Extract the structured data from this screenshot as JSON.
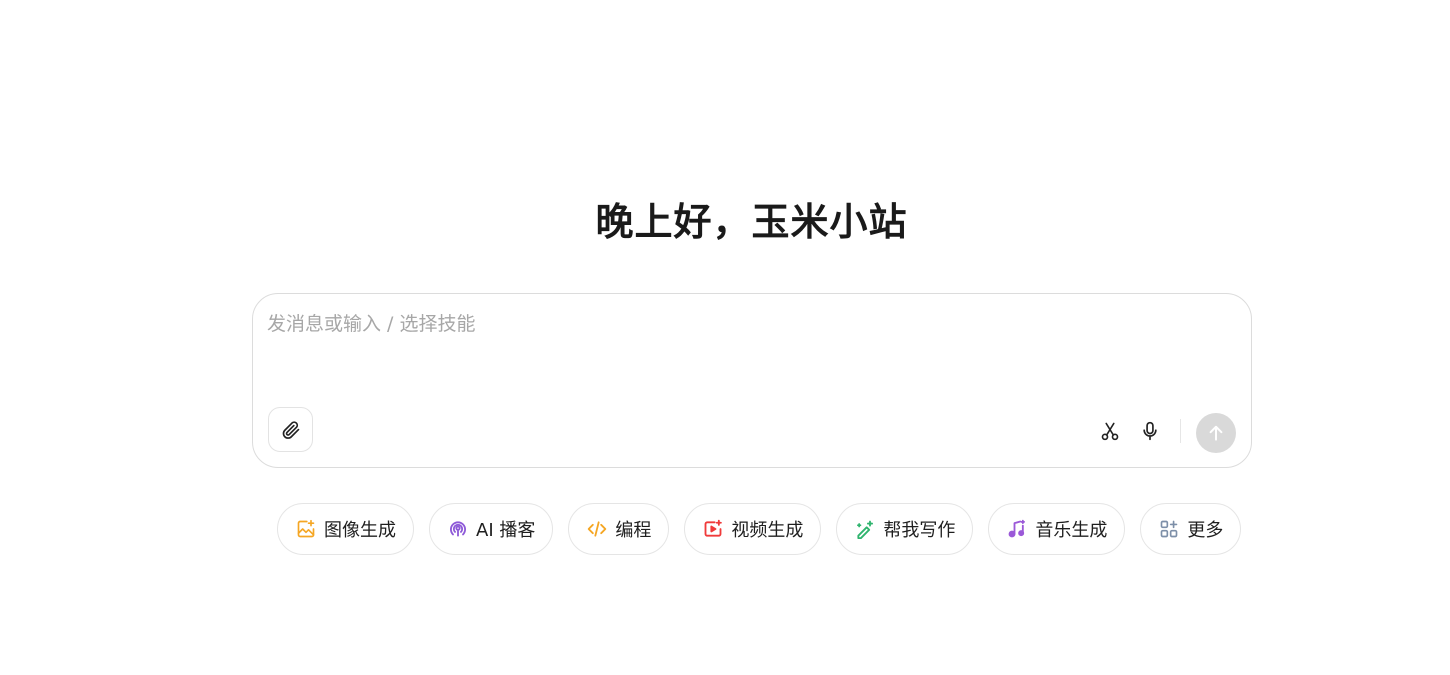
{
  "greeting": "晚上好，玉米小站",
  "composer": {
    "placeholder": "发消息或输入 / 选择技能",
    "value": ""
  },
  "skills": [
    {
      "label": "图像生成",
      "icon": "image-sparkle-icon",
      "color": "#f5a623"
    },
    {
      "label": "AI 播客",
      "icon": "podcast-icon",
      "color": "#8e5ad8"
    },
    {
      "label": "编程",
      "icon": "code-icon",
      "color": "#f5a623"
    },
    {
      "label": "视频生成",
      "icon": "video-play-icon",
      "color": "#f03a3a"
    },
    {
      "label": "帮我写作",
      "icon": "pen-sparkle-icon",
      "color": "#2fb46e"
    },
    {
      "label": "音乐生成",
      "icon": "music-note-icon",
      "color": "#9b59d8"
    },
    {
      "label": "更多",
      "icon": "grid-plus-icon",
      "color": "#7d8fa8"
    }
  ],
  "colors": {
    "send_disabled": "#d9d9d9",
    "placeholder": "#a7a7a7",
    "border": "#dcdcdc"
  }
}
